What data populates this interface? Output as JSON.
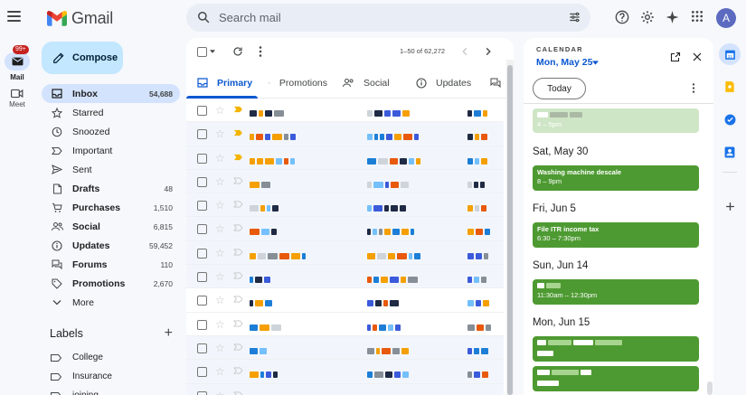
{
  "app": {
    "name": "Gmail",
    "avatar_initial": "A"
  },
  "search": {
    "placeholder": "Search mail"
  },
  "rail": {
    "mail_badge": "99+",
    "mail_label": "Mail",
    "meet_label": "Meet"
  },
  "compose": {
    "label": "Compose"
  },
  "nav": {
    "items": [
      {
        "label": "Inbox",
        "count": "54,688",
        "icon": "inbox-icon",
        "bold": true,
        "active": true
      },
      {
        "label": "Starred",
        "count": "",
        "icon": "star-icon",
        "bold": false
      },
      {
        "label": "Snoozed",
        "count": "",
        "icon": "clock-icon",
        "bold": false
      },
      {
        "label": "Important",
        "count": "",
        "icon": "important-icon",
        "bold": false
      },
      {
        "label": "Sent",
        "count": "",
        "icon": "send-icon",
        "bold": false
      },
      {
        "label": "Drafts",
        "count": "48",
        "icon": "draft-icon",
        "bold": true
      },
      {
        "label": "Purchases",
        "count": "1,510",
        "icon": "cart-icon",
        "bold": true
      },
      {
        "label": "Social",
        "count": "6,815",
        "icon": "people-icon",
        "bold": true
      },
      {
        "label": "Updates",
        "count": "59,452",
        "icon": "info-icon",
        "bold": true
      },
      {
        "label": "Forums",
        "count": "110",
        "icon": "forum-icon",
        "bold": true
      },
      {
        "label": "Promotions",
        "count": "2,670",
        "icon": "tag-icon",
        "bold": true
      },
      {
        "label": "More",
        "count": "",
        "icon": "chevron-down-icon",
        "bold": false
      }
    ]
  },
  "labels": {
    "heading": "Labels",
    "items": [
      {
        "label": "College"
      },
      {
        "label": "Insurance"
      },
      {
        "label": "joining"
      }
    ]
  },
  "toolbar": {
    "pager_text": "1–50 of 62,272"
  },
  "tabs": [
    {
      "label": "Primary",
      "icon": "inbox-icon",
      "active": true
    },
    {
      "label": "Promotions",
      "icon": "tag-icon",
      "active": false
    },
    {
      "label": "Social",
      "icon": "people-icon",
      "active": false
    },
    {
      "label": "Updates",
      "icon": "info-icon",
      "active": false
    }
  ],
  "rows": [
    {
      "read": false,
      "important": true
    },
    {
      "read": true,
      "important": true
    },
    {
      "read": true,
      "important": true
    },
    {
      "read": true,
      "important": false
    },
    {
      "read": true,
      "important": false
    },
    {
      "read": true,
      "important": false
    },
    {
      "read": true,
      "important": false
    },
    {
      "read": true,
      "important": false
    },
    {
      "read": false,
      "important": false
    },
    {
      "read": false,
      "important": false
    },
    {
      "read": true,
      "important": false
    },
    {
      "read": true,
      "important": false
    },
    {
      "read": true,
      "important": false
    }
  ],
  "calendar": {
    "title": "CALENDAR",
    "current_date": "Mon, May 25",
    "today_label": "Today",
    "days": [
      {
        "heading": "",
        "events": [
          {
            "title": "",
            "time": "4 – 5pm",
            "muted": true
          }
        ]
      },
      {
        "heading": "Sat, May 30",
        "events": [
          {
            "title": "Washing machine descale",
            "time": "8 – 9pm"
          }
        ]
      },
      {
        "heading": "Fri, Jun 5",
        "events": [
          {
            "title": "File ITR income tax",
            "time": "6:30 – 7:30pm"
          }
        ]
      },
      {
        "heading": "Sun, Jun 14",
        "events": [
          {
            "title": "",
            "time": "11:30am – 12:30pm"
          }
        ]
      },
      {
        "heading": "Mon, Jun 15",
        "events": [
          {
            "title": "",
            "time": ""
          },
          {
            "title": "",
            "time": ""
          }
        ]
      }
    ]
  },
  "colors": {
    "accent": "#0b57d0",
    "compose_bg": "#c2e7ff",
    "active_nav": "#d3e3fd",
    "event_green": "#4e9a32",
    "important_marker": "#f4b400"
  }
}
